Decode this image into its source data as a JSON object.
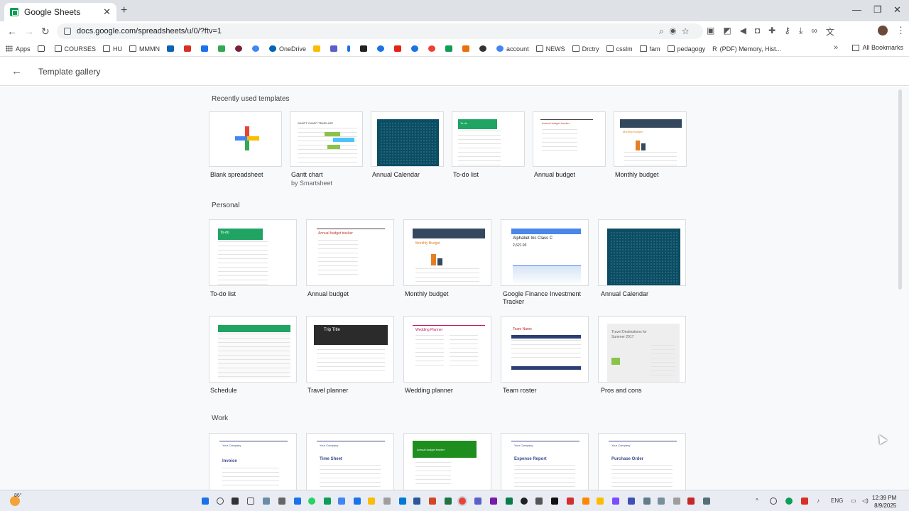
{
  "browser": {
    "tab_title": "Google Sheets",
    "url": "docs.google.com/spreadsheets/u/0/?ftv=1",
    "bookmarks": [
      "Apps",
      "COURSES",
      "HU",
      "MMMN",
      "OneDrive",
      "account",
      "NEWS",
      "Drctry",
      "csslm",
      "fam",
      "pedagogy",
      "(PDF) Memory, Hist..."
    ],
    "all_bookmarks": "All Bookmarks"
  },
  "header": {
    "title": "Template gallery"
  },
  "sections": {
    "recent": {
      "title": "Recently used templates",
      "items": [
        {
          "label": "Blank spreadsheet",
          "sub": ""
        },
        {
          "label": "Gantt chart",
          "sub": "by Smartsheet"
        },
        {
          "label": "Annual Calendar",
          "sub": ""
        },
        {
          "label": "To-do list",
          "sub": ""
        },
        {
          "label": "Annual budget",
          "sub": ""
        },
        {
          "label": "Monthly budget",
          "sub": ""
        }
      ]
    },
    "personal": {
      "title": "Personal",
      "items": [
        {
          "label": "To-do list"
        },
        {
          "label": "Annual budget"
        },
        {
          "label": "Monthly budget"
        },
        {
          "label": "Google Finance Investment Tracker"
        },
        {
          "label": "Annual Calendar"
        },
        {
          "label": "Schedule"
        },
        {
          "label": "Travel planner"
        },
        {
          "label": "Wedding planner"
        },
        {
          "label": "Team roster"
        },
        {
          "label": "Pros and cons"
        }
      ]
    },
    "work": {
      "title": "Work"
    }
  },
  "thumbs": {
    "gantt": "GANTT CHART TEMPLATE",
    "todo": "To-do",
    "annual_budget": "Annual budget tracker",
    "monthly_budget": "Monthly Budget",
    "finance": "Alphabet Inc Class C",
    "finance_value": "2,621.93",
    "trip": "Trip Title",
    "wedding": "Wedding Planner",
    "team": "Team Name",
    "pros": "Travel Destinations for Summer 2017",
    "invoice": "Invoice",
    "timesheet": "Time Sheet",
    "annual_budget_tracker": "Annual budget tracker",
    "expense": "Expense Report",
    "po": "Purchase Order",
    "company": "Your Company"
  },
  "taskbar": {
    "weather": "86°",
    "lang": "ENG",
    "time": "12:39 PM",
    "date": "8/9/2025"
  }
}
